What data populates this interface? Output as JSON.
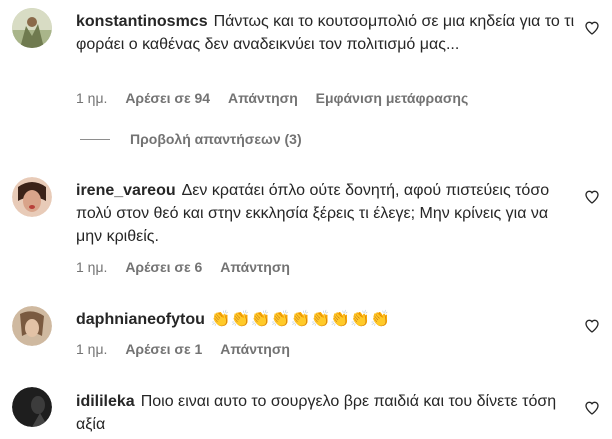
{
  "comments": [
    {
      "username": "konstantinosmcs",
      "text": "Πάντως και το κουτσομπολιό σε μια κηδεία για το τι φοράει ο καθένας δεν αναδεικνύει τον πολιτισμό μας...",
      "time": "1 ημ.",
      "likes": "Αρέσει σε 94",
      "reply": "Απάντηση",
      "translate": "Εμφάνιση μετάφρασης",
      "avatar_color": "#8a9a6b"
    },
    {
      "username": "irene_vareou",
      "text": "Δεν κρατάει όπλο ούτε δονητή, αφού πιστεύεις τόσο πολύ στον θεό και στην εκκλησία ξέρεις τι έλεγε; Μην κρίνεις για να μην κριθείς.",
      "time": "1 ημ.",
      "likes": "Αρέσει σε 6",
      "reply": "Απάντηση",
      "avatar_color": "#c45a4a"
    },
    {
      "username": "daphnianeofytou",
      "text": "👏👏👏👏👏👏👏👏👏",
      "time": "1 ημ.",
      "likes": "Αρέσει σε 1",
      "reply": "Απάντηση",
      "avatar_color": "#b9987a"
    },
    {
      "username": "idilileka",
      "text": "Ποιο ειναι αυτο το σουργελο βρε παιδιά και του δίνετε τόση αξία",
      "avatar_color": "#2a2a2a"
    }
  ],
  "view_replies": "Προβολή απαντήσεων (3)",
  "icons": {
    "like": "heart-outline-icon"
  }
}
